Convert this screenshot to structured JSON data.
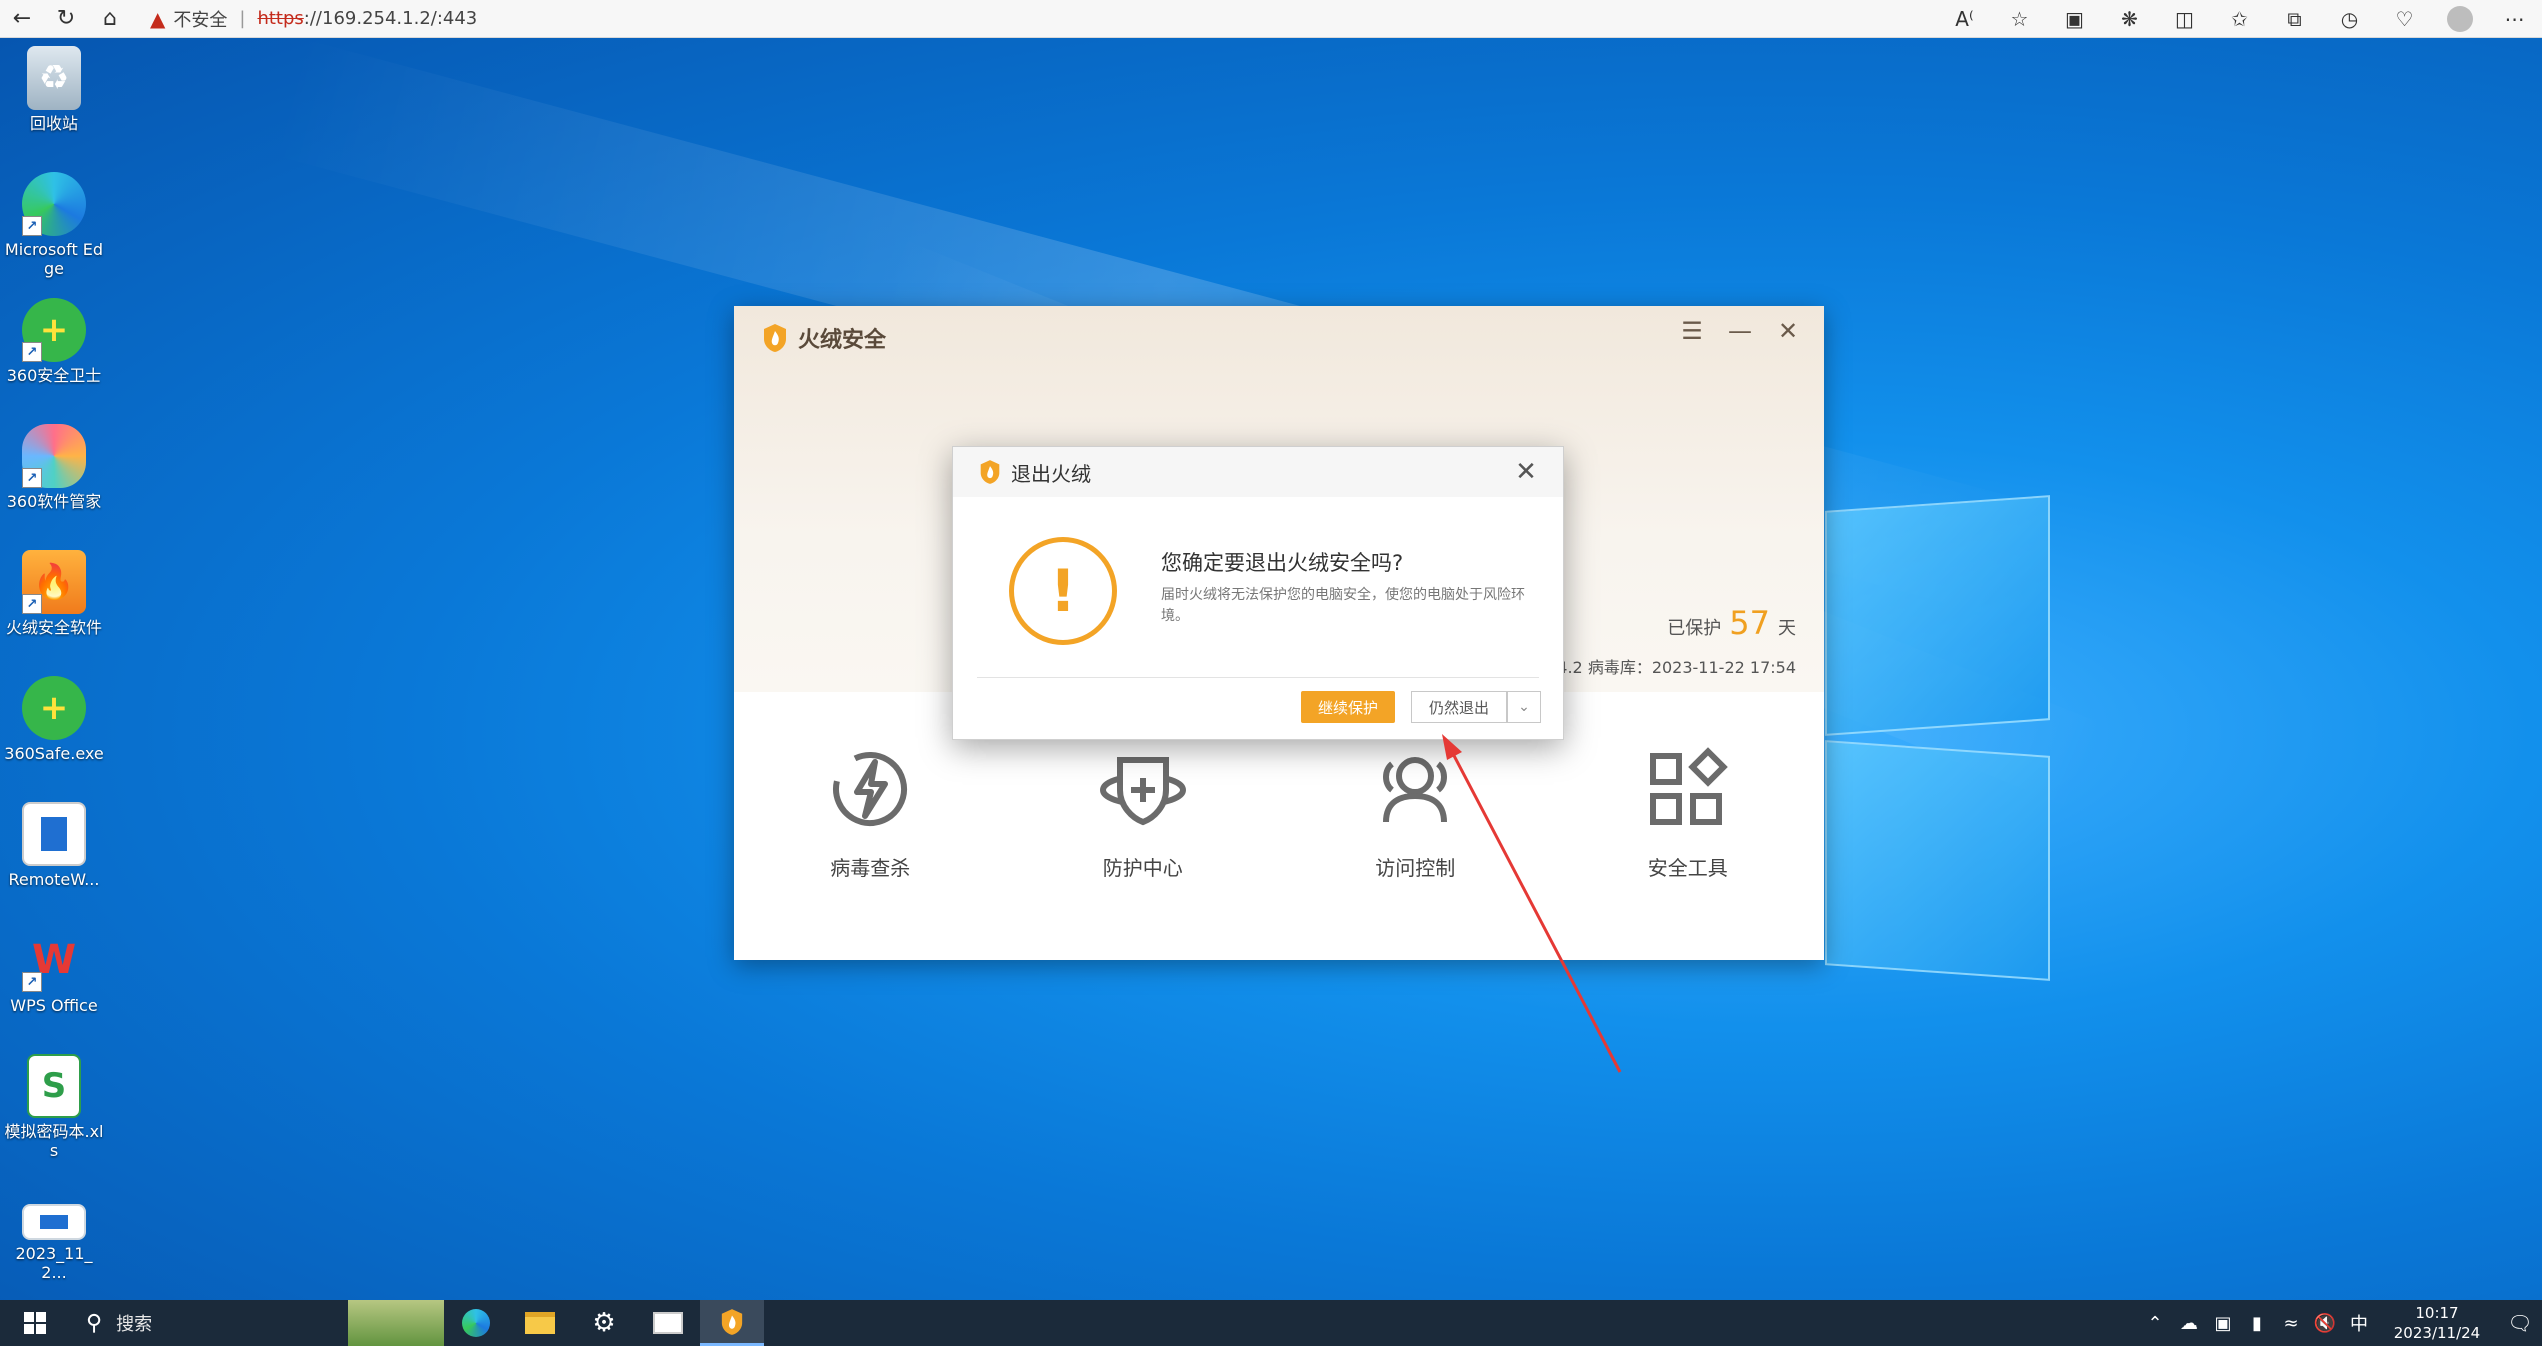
{
  "browser": {
    "warning_text": "不安全",
    "url_scheme": "https",
    "url_rest": "://169.254.1.2/:443"
  },
  "desktop_icons": [
    {
      "label": "回收站"
    },
    {
      "label": "Microsoft Edge"
    },
    {
      "label": "360安全卫士"
    },
    {
      "label": "360软件管家"
    },
    {
      "label": "火绒安全软件"
    },
    {
      "label": "360Safe.exe"
    },
    {
      "label": "RemoteW..."
    },
    {
      "label": "WPS Office"
    },
    {
      "label": "模拟密码本.xls"
    },
    {
      "label": "2023_11_2..."
    }
  ],
  "app": {
    "title": "火绒安全",
    "protected_prefix": "已保护",
    "protected_days": "57",
    "protected_suffix": "天",
    "version_info": "4.2  病毒库：2023-11-22 17:54",
    "features": [
      {
        "label": "病毒查杀",
        "icon": "lightning-icon"
      },
      {
        "label": "防护中心",
        "icon": "shield-plus-icon"
      },
      {
        "label": "访问控制",
        "icon": "users-icon"
      },
      {
        "label": "安全工具",
        "icon": "grid-tools-icon"
      }
    ]
  },
  "dialog": {
    "title": "退出火绒",
    "question": "您确定要退出火绒安全吗?",
    "description": "届时火绒将无法保护您的电脑安全，使您的电脑处于风险环境。",
    "continue_button": "继续保护",
    "exit_button": "仍然退出"
  },
  "taskbar": {
    "search_label": "搜索",
    "ime": "中",
    "time": "10:17",
    "date": "2023/11/24"
  },
  "colors": {
    "accent_orange": "#f3a426",
    "annotation_arrow": "#e53935",
    "desktop_blue": "#0a78d7"
  }
}
